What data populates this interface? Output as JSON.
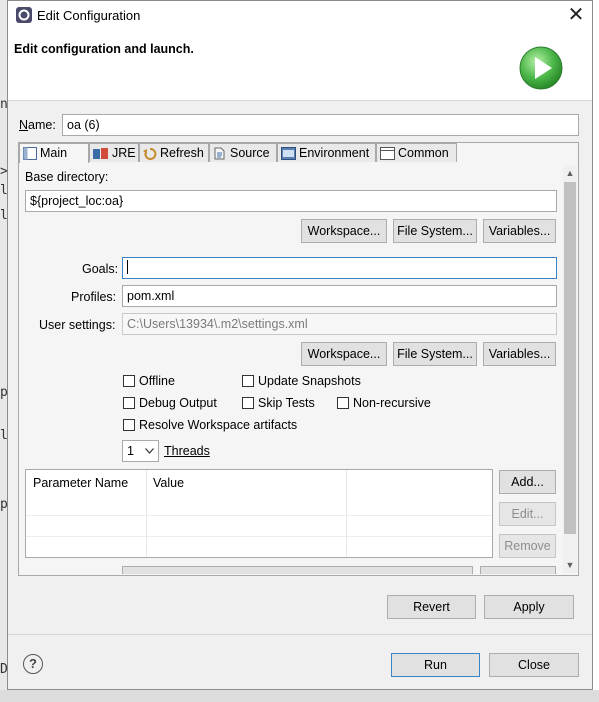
{
  "window": {
    "title": "Edit Configuration"
  },
  "banner": {
    "title": "Edit configuration and launch."
  },
  "name_field": {
    "label": "Name:",
    "value": "oa (6)"
  },
  "tabs": [
    {
      "label": "Main",
      "icon": "main-tab-icon"
    },
    {
      "label": "JRE",
      "icon": "jre-icon"
    },
    {
      "label": "Refresh",
      "icon": "refresh-icon"
    },
    {
      "label": "Source",
      "icon": "source-icon"
    },
    {
      "label": "Environment",
      "icon": "environment-icon"
    },
    {
      "label": "Common",
      "icon": "common-icon"
    }
  ],
  "main": {
    "base_directory": {
      "label": "Base directory:",
      "value": "${project_loc:oa}"
    },
    "dir_buttons": {
      "workspace": "Workspace...",
      "file_system": "File System...",
      "variables": "Variables..."
    },
    "goals": {
      "label": "Goals:",
      "value": ""
    },
    "profiles": {
      "label": "Profiles:",
      "value": "pom.xml"
    },
    "user_settings": {
      "label": "User settings:",
      "value": "C:\\Users\\13934\\.m2\\settings.xml"
    },
    "settings_buttons": {
      "workspace": "Workspace...",
      "file_system": "File System...",
      "variables": "Variables..."
    },
    "options": {
      "offline": "Offline",
      "update_snapshots": "Update Snapshots",
      "debug_output": "Debug Output",
      "skip_tests": "Skip Tests",
      "non_recursive": "Non-recursive",
      "resolve_workspace": "Resolve Workspace artifacts"
    },
    "threads": {
      "value": "1",
      "label": "Threads"
    },
    "params_table": {
      "columns": [
        "Parameter Name",
        "Value"
      ]
    },
    "table_buttons": {
      "add": "Add...",
      "edit": "Edit...",
      "remove": "Remove"
    }
  },
  "footer": {
    "revert": "Revert",
    "apply": "Apply",
    "run": "Run",
    "close": "Close",
    "help": "?"
  },
  "colors": {
    "accent": "#3c83c4",
    "run_icon": "#3aa53a"
  }
}
